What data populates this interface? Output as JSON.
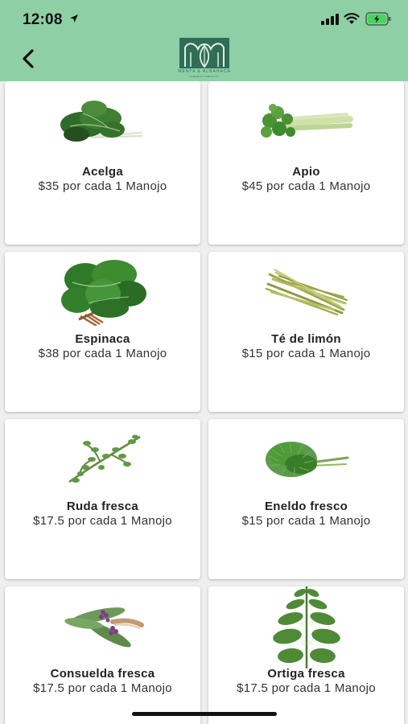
{
  "status_bar": {
    "time": "12:08"
  },
  "header": {
    "logo_text": "MENTA & ALBAHACA",
    "logo_sub": "HIERBAS FRESCAS"
  },
  "colors": {
    "header_bg": "#8fcfa6",
    "logo_green": "#2f6d57",
    "card_bg": "#ffffff"
  },
  "products": [
    {
      "name": "Acelga",
      "price": "$35 por cada 1 Manojo",
      "icon": "chard-icon"
    },
    {
      "name": "Apio",
      "price": "$45 por cada 1 Manojo",
      "icon": "celery-icon"
    },
    {
      "name": "Espinaca",
      "price": "$38 por cada 1 Manojo",
      "icon": "spinach-icon"
    },
    {
      "name": "Té  de limón",
      "price": "$15 por cada 1 Manojo",
      "icon": "lemongrass-icon"
    },
    {
      "name": "Ruda fresca",
      "price": "$17.5 por cada 1 Manojo",
      "icon": "rue-icon"
    },
    {
      "name": "Eneldo fresco",
      "price": "$15 por cada 1 Manojo",
      "icon": "dill-icon"
    },
    {
      "name": "Consuelda fresca",
      "price": "$17.5 por cada 1 Manojo",
      "icon": "comfrey-icon"
    },
    {
      "name": "Ortiga fresca",
      "price": "$17.5 por cada 1 Manojo",
      "icon": "nettle-icon"
    }
  ]
}
